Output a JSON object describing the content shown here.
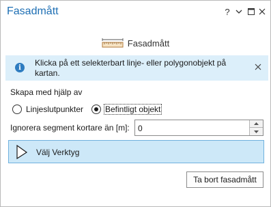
{
  "window": {
    "title": "Fasadmått",
    "help_glyph": "?",
    "menu_glyph": "⌄",
    "restore_glyph": "▭",
    "close_glyph": "✕"
  },
  "header": {
    "tool_title": "Fasadmått",
    "icon": "ruler-icon"
  },
  "info": {
    "icon": "info-icon",
    "icon_glyph": "i",
    "text": "Klicka på ett selekterbart linje- eller polygonobjekt på kartan.",
    "close_glyph": "✕"
  },
  "create": {
    "label": "Skapa med hjälp av",
    "options": [
      {
        "label": "Linjeslutpunkter",
        "selected": false
      },
      {
        "label": "Befintligt objekt",
        "selected": true
      }
    ]
  },
  "ignore": {
    "label": "Ignorera segment kortare än [m]:",
    "value": "0"
  },
  "tool": {
    "label": "Välj Verktyg",
    "icon": "pointer-arrow-icon"
  },
  "delete_button": {
    "label": "Ta bort fasadmått"
  },
  "colors": {
    "title": "#1e6fb4",
    "info_background": "#dceffa",
    "tool_background": "#cde8f8",
    "tool_border": "#6fb1de"
  }
}
